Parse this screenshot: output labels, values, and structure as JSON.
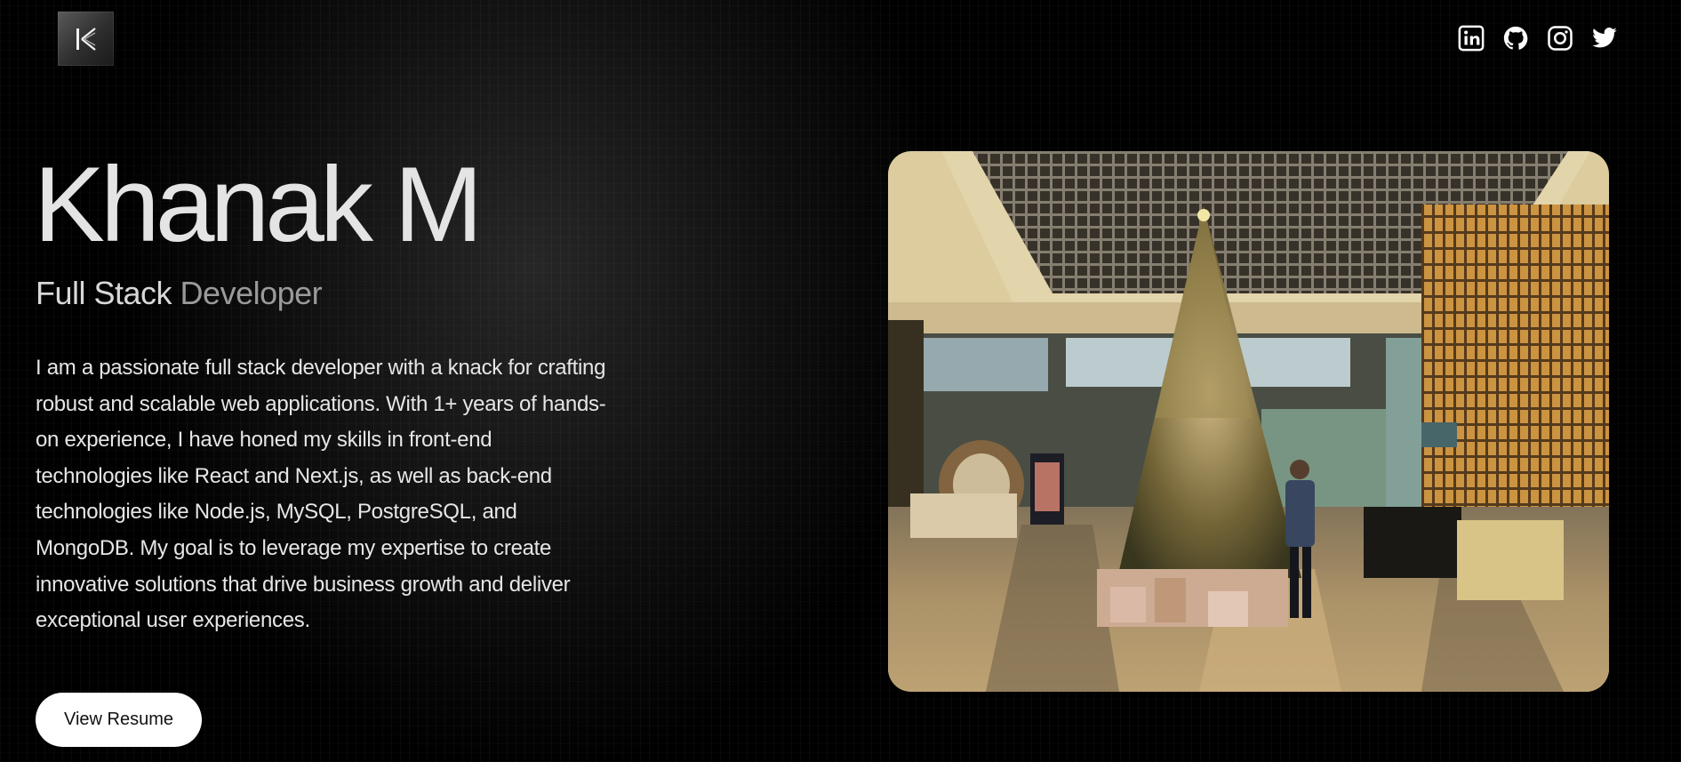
{
  "header": {
    "logo_icon": "k-monogram-logo",
    "social": [
      {
        "name": "linkedin-icon"
      },
      {
        "name": "github-icon"
      },
      {
        "name": "instagram-icon"
      },
      {
        "name": "twitter-icon"
      }
    ]
  },
  "hero": {
    "name": "Khanak M",
    "role_part1": "Full Stack ",
    "role_part2": "Developer",
    "bio": "I am a passionate full stack developer with a knack for crafting robust and scalable web applications. With 1+ years of hands-on experience, I have honed my skills in front-end technologies like React and Next.js, as well as back-end technologies like Node.js, MySQL, PostgreSQL, and MongoDB. My goal is to leverage my expertise to create innovative solutions that drive business growth and deliver exceptional user experiences.",
    "resume_label": "View Resume"
  },
  "colors": {
    "background": "#000000",
    "name_text": "#e4e4e4",
    "role_dim": "#9a9a9a",
    "button_bg": "#ffffff"
  }
}
